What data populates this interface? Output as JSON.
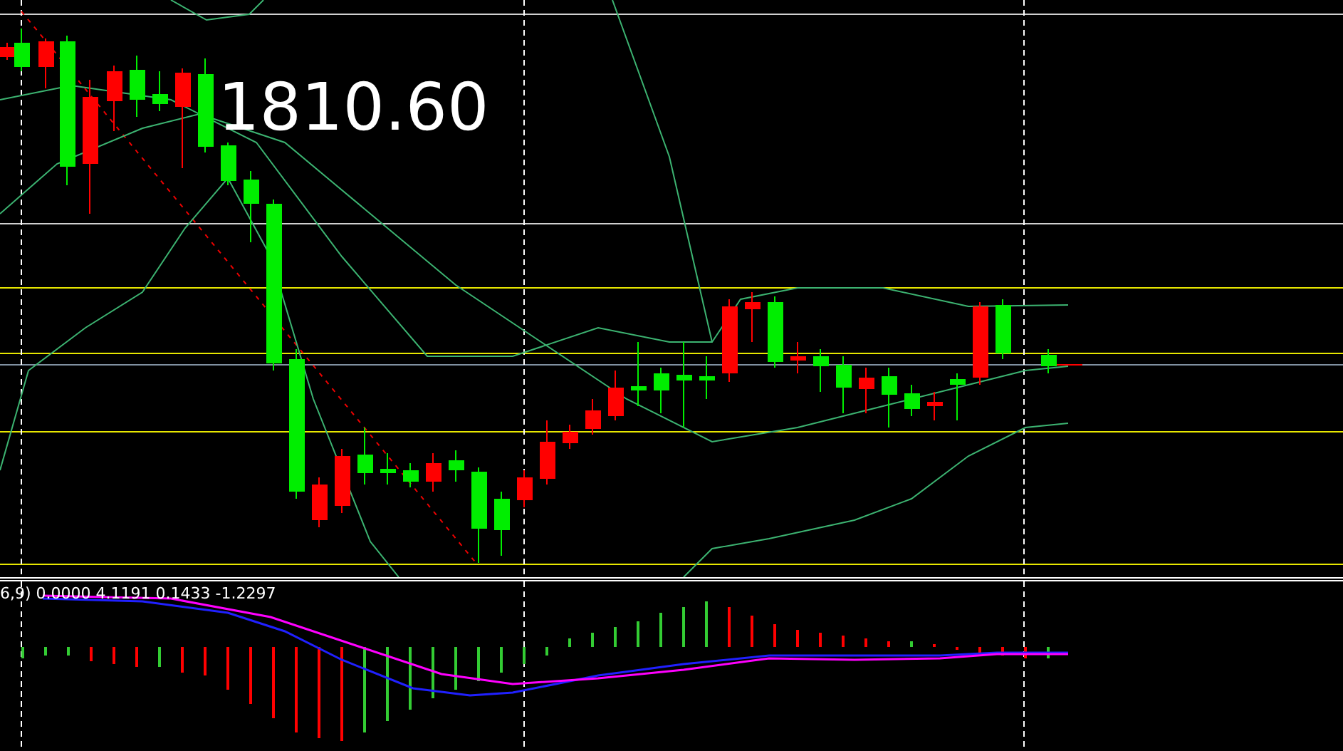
{
  "price_chart": {
    "price_label": "1810.60"
  },
  "indicator_panel": {
    "header": "6,9) 0.0000 4.1191 0.1433 -1.2297"
  }
}
